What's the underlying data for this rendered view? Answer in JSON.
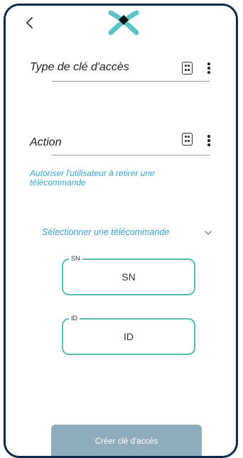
{
  "header": {
    "back_icon": "chevron-left-icon",
    "logo": "brand-logo-x"
  },
  "access_key_type": {
    "label": "Type de clé d'accès",
    "card_icon": "card-icon",
    "menu_icon": "more-vertical-icon"
  },
  "action": {
    "label": "Action",
    "card_icon": "card-icon",
    "menu_icon": "more-vertical-icon",
    "helper_text": "Autoriser l'utilisateur à retirer une télécommande"
  },
  "remote_select": {
    "label": "Sélectionner une télécommande",
    "chevron_icon": "chevron-down-icon"
  },
  "sn_field": {
    "legend": "SN",
    "placeholder": "SN"
  },
  "id_field": {
    "legend": "ID",
    "placeholder": "ID"
  },
  "footer": {
    "create_label": "Créer clé d'accès"
  },
  "colors": {
    "frame": "#0b2a4a",
    "accent_text": "#3aa0c8",
    "field_border": "#59bdb6",
    "button_bg": "#8eacbc"
  }
}
